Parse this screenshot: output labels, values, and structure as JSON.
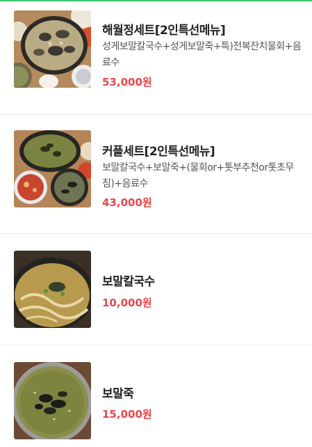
{
  "theme": {
    "accent": "#3cc36b",
    "price_color": "#e8474b"
  },
  "menu": [
    {
      "name": "해월정세트[2인특선메뉴]",
      "desc": "성게보말칼국수+성게보말죽+특)전복잔치물회+음료수",
      "price": "53,000원",
      "image": "seafood-set-meal-photo"
    },
    {
      "name": "커플세트[2인특선메뉴]",
      "desc": "보말칼국수+보말죽+(물회or+톳부추천or톳초무침)+음료수",
      "price": "43,000원",
      "image": "couple-set-meal-photo"
    },
    {
      "name": "보말칼국수",
      "desc": "",
      "price": "10,000원",
      "image": "noodle-soup-photo"
    },
    {
      "name": "보말죽",
      "desc": "",
      "price": "15,000원",
      "image": "porridge-photo"
    }
  ]
}
